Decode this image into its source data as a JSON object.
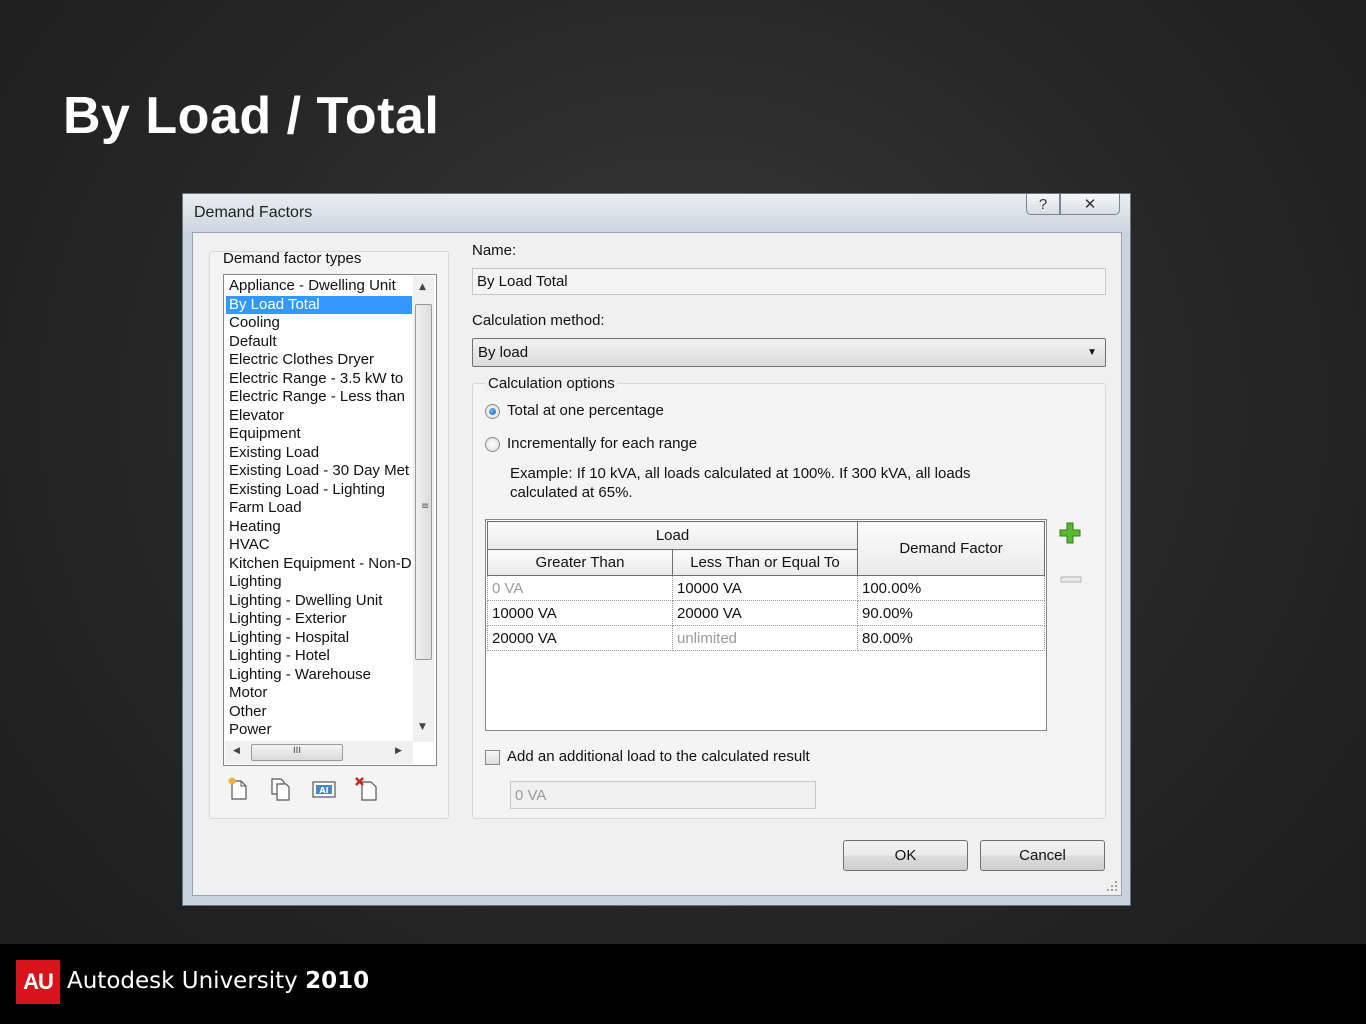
{
  "slide": {
    "title": "By Load / Total"
  },
  "dialog": {
    "title": "Demand Factors",
    "help_label": "?",
    "close_label": "✕",
    "types_group_label": "Demand factor types",
    "types": [
      "Appliance - Dwelling Unit",
      "By Load Total",
      "Cooling",
      "Default",
      "Electric Clothes Dryer",
      "Electric Range - 3.5 kW to",
      "Electric Range - Less than",
      "Elevator",
      "Equipment",
      "Existing Load",
      "Existing Load - 30 Day Met",
      "Existing Load - Lighting",
      "Farm Load",
      "Heating",
      "HVAC",
      "Kitchen Equipment - Non-D",
      "Lighting",
      "Lighting - Dwelling Unit",
      "Lighting - Exterior",
      "Lighting - Hospital",
      "Lighting - Hotel",
      "Lighting - Warehouse",
      "Motor",
      "Other",
      "Power"
    ],
    "selected_type_index": 1,
    "hscroll_grip": "III",
    "name_label": "Name:",
    "name_value": "By Load Total",
    "calc_method_label": "Calculation method:",
    "calc_method_value": "By load",
    "calc_options_label": "Calculation options",
    "option_total_label": "Total at one percentage",
    "option_incremental_label": "Incrementally for each range",
    "example_text": "Example: If 10 kVA, all loads calculated at 100%. If 300 kVA, all loads calculated at 65%.",
    "table": {
      "load_header": "Load",
      "greater_header": "Greater Than",
      "less_header": "Less Than or Equal To",
      "factor_header": "Demand Factor",
      "rows": [
        {
          "greater": "0 VA",
          "less": "10000 VA",
          "factor": "100.00%"
        },
        {
          "greater": "10000 VA",
          "less": "20000 VA",
          "factor": "90.00%"
        },
        {
          "greater": "20000 VA",
          "less": "unlimited",
          "factor": "80.00%"
        }
      ]
    },
    "additional_load_label": "Add an additional load to the calculated result",
    "additional_load_value": "0 VA",
    "ok_label": "OK",
    "cancel_label": "Cancel",
    "accent_color": "#3399ff"
  },
  "footer": {
    "logo_text": "AU",
    "brand_name": "Autodesk University",
    "brand_year": "2010",
    "logo_color": "#d7141a"
  }
}
